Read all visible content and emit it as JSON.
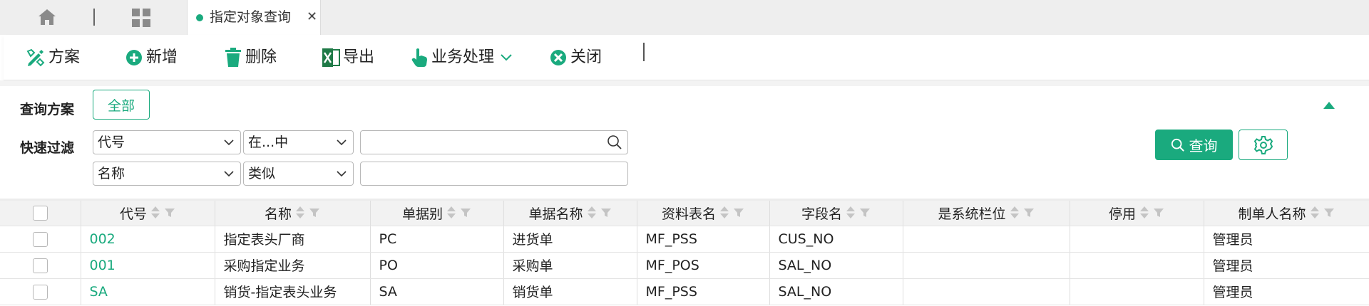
{
  "tabs": {
    "active_label": "指定对象查询",
    "close_glyph": "✕"
  },
  "toolbar": {
    "plan": "方案",
    "add": "新增",
    "delete": "删除",
    "export": "导出",
    "business": "业务处理",
    "close": "关闭"
  },
  "filter": {
    "scheme_label": "查询方案",
    "all_button": "全部",
    "quick_label": "快速过滤",
    "row1": {
      "field": "代号",
      "operator": "在...中",
      "value": ""
    },
    "row2": {
      "field": "名称",
      "operator": "类似",
      "value": ""
    },
    "query_button": "查询"
  },
  "table": {
    "columns": [
      "代号",
      "名称",
      "单据别",
      "单据名称",
      "资料表名",
      "字段名",
      "是系统栏位",
      "停用",
      "制单人名称"
    ],
    "rows": [
      [
        "002",
        "指定表头厂商",
        "PC",
        "进货单",
        "MF_PSS",
        "CUS_NO",
        "",
        "",
        "管理员"
      ],
      [
        "001",
        "采购指定业务",
        "PO",
        "采购单",
        "MF_POS",
        "SAL_NO",
        "",
        "",
        "管理员"
      ],
      [
        "SA",
        "销货-指定表头业务",
        "SA",
        "销货单",
        "MF_PSS",
        "SAL_NO",
        "",
        "",
        "管理员"
      ]
    ]
  },
  "colors": {
    "accent": "#1aaa7e",
    "export_icon": "#1f7a47",
    "delete_icon": "#1aaa7e"
  },
  "icons": {
    "home": "home-icon",
    "grid": "grid-icon",
    "plan": "pencil-ruler-icon",
    "add": "plus-circle-icon",
    "delete": "trash-icon",
    "export": "excel-icon",
    "business": "hand-pointer-icon",
    "close": "x-circle-icon",
    "search": "search-icon",
    "settings": "gear-icon"
  }
}
